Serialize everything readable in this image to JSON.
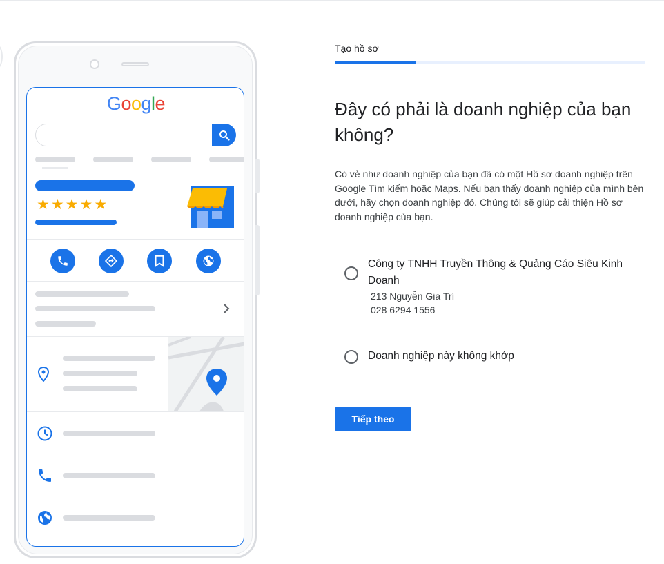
{
  "illustration": {
    "google_logo": [
      {
        "ch": "G",
        "color": "#4285F4"
      },
      {
        "ch": "o",
        "color": "#EA4335"
      },
      {
        "ch": "o",
        "color": "#FBBC05"
      },
      {
        "ch": "g",
        "color": "#4285F4"
      },
      {
        "ch": "l",
        "color": "#34A853"
      },
      {
        "ch": "e",
        "color": "#EA4335"
      }
    ],
    "rating_stars": 5,
    "accent_color": "#1a73e8",
    "star_color": "#f9ab00",
    "action_icons": [
      "phone-icon",
      "directions-icon",
      "bookmark-icon",
      "globe-icon"
    ],
    "row_icons": [
      "location-pin-icon",
      "clock-icon",
      "phone-icon",
      "globe-icon"
    ]
  },
  "header": {
    "step_label": "Tạo hồ sơ",
    "progress": 0.26
  },
  "main": {
    "heading": "Đây có phải là doanh nghiệp của bạn không?",
    "description": "Có vẻ như doanh nghiệp của bạn đã có một Hồ sơ doanh nghiệp trên Google Tìm kiếm hoặc Maps. Nếu bạn thấy doanh nghiệp của mình bên dưới, hãy chọn doanh nghiệp đó. Chúng tôi sẽ giúp cải thiện Hồ sơ doanh nghiệp của bạn.",
    "options": [
      {
        "name": "Công ty TNHH Truyền Thông & Quảng Cáo Siêu Kinh Doanh",
        "address": "213 Nguyễn Gia Trí",
        "phone": "028 6294 1556",
        "selected": false
      },
      {
        "name": "Doanh nghiệp này không khớp",
        "selected": false
      }
    ],
    "next_button": "Tiếp theo"
  }
}
